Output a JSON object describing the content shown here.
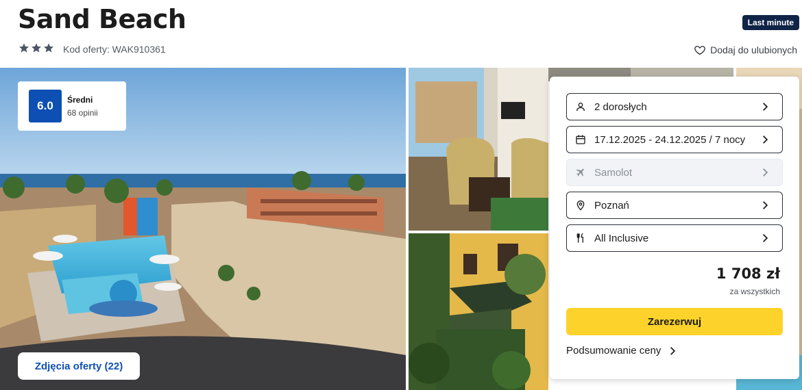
{
  "hotel": {
    "name": "Sand Beach",
    "stars": 3,
    "offer_code": "Kod oferty: WAK910361",
    "badge": "Last minute",
    "favorite_label": "Dodaj do ulubionych"
  },
  "rating": {
    "score": "6.0",
    "label": "Średni",
    "count": "68 opinii"
  },
  "gallery": {
    "photos_button": "Zdjęcia oferty (22)"
  },
  "booking": {
    "fields": [
      {
        "icon": "person-icon",
        "text": "2 dorosłych",
        "disabled": false
      },
      {
        "icon": "calendar-icon",
        "text": "17.12.2025 - 24.12.2025 / 7 nocy",
        "disabled": false
      },
      {
        "icon": "plane-icon",
        "text": "Samolot",
        "disabled": true
      },
      {
        "icon": "location-pin-icon",
        "text": "Poznań",
        "disabled": false
      },
      {
        "icon": "cutlery-icon",
        "text": "All Inclusive",
        "disabled": false
      }
    ],
    "price": "1 708 zł",
    "price_note": "za wszystkich",
    "book_button": "Zarezerwuj",
    "summary_link": "Podsumowanie ceny"
  },
  "colors": {
    "accent_blue": "#0d4fb3",
    "badge_navy": "#0f2446",
    "cta_yellow": "#fdd22b"
  }
}
